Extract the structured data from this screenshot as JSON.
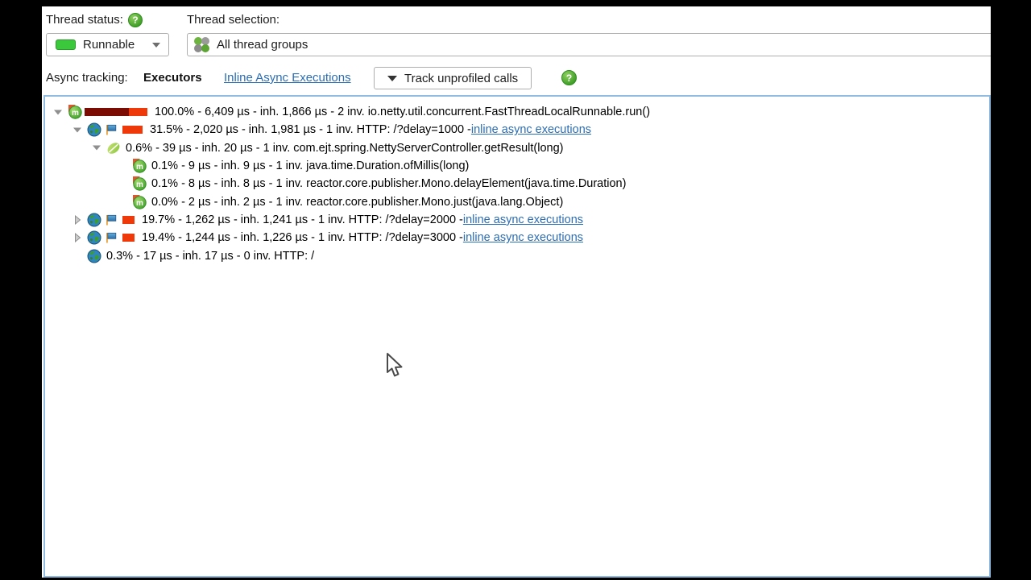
{
  "header": {
    "thread_status_label": "Thread status:",
    "thread_selection_label": "Thread selection:",
    "help_glyph": "?",
    "thread_status_value": "Runnable",
    "thread_selection_value": "All thread groups",
    "status_swatch_color": "#3cc83c"
  },
  "async": {
    "label": "Async tracking:",
    "mode": "Executors",
    "link": "Inline Async Executions",
    "button_label": "Track unprofiled calls"
  },
  "colors": {
    "link": "#2a6db5",
    "bar_total": "#7a0c04",
    "bar_inherent": "#ee3a0b",
    "panel_border": "#92bbe2",
    "status_green": "#3cc83c"
  },
  "tree": {
    "bar_full_width": 78,
    "rows": [
      {
        "indent": 9,
        "expander": "down",
        "icon": "method",
        "flag": false,
        "bar": {
          "pct": 100.0,
          "self_frac": 0.29
        },
        "text": "100.0% - 6,409 µs - inh. 1,866 µs - 2 inv. io.netty.util.concurrent.FastThreadLocalRunnable.run()",
        "link": null
      },
      {
        "indent": 33,
        "expander": "down",
        "icon": "globe",
        "flag": true,
        "bar": {
          "pct": 31.5,
          "self_frac": 0.98
        },
        "text": "31.5% - 2,020 µs - inh. 1,981 µs - 1 inv. HTTP: /?delay=1000 - ",
        "link": "inline async executions"
      },
      {
        "indent": 57,
        "expander": "down",
        "icon": "leaf",
        "flag": false,
        "bar": null,
        "text": "0.6% - 39 µs - inh. 20 µs - 1 inv. com.ejt.spring.NettyServerController.getResult(long)",
        "link": null
      },
      {
        "indent": 108,
        "expander": null,
        "icon": "method",
        "flag": false,
        "bar": null,
        "text": "0.1% - 9 µs - inh. 9 µs - 1 inv. java.time.Duration.ofMillis(long)",
        "link": null
      },
      {
        "indent": 108,
        "expander": null,
        "icon": "method",
        "flag": false,
        "bar": null,
        "text": "0.1% - 8 µs - inh. 8 µs - 1 inv. reactor.core.publisher.Mono.delayElement(java.time.Duration)",
        "link": null
      },
      {
        "indent": 108,
        "expander": null,
        "icon": "method",
        "flag": false,
        "bar": null,
        "text": "0.0% - 2 µs - inh. 2 µs - 1 inv. reactor.core.publisher.Mono.just(java.lang.Object)",
        "link": null
      },
      {
        "indent": 33,
        "expander": "right",
        "icon": "globe",
        "flag": true,
        "bar": {
          "pct": 19.7,
          "self_frac": 0.985
        },
        "text": "19.7% - 1,262 µs - inh. 1,241 µs - 1 inv. HTTP: /?delay=2000 - ",
        "link": "inline async executions"
      },
      {
        "indent": 33,
        "expander": "right",
        "icon": "globe",
        "flag": true,
        "bar": {
          "pct": 19.4,
          "self_frac": 0.985
        },
        "text": "19.4% - 1,244 µs - inh. 1,226 µs - 1 inv. HTTP: /?delay=3000 - ",
        "link": "inline async executions"
      },
      {
        "indent": 52,
        "expander": null,
        "icon": "globe",
        "flag": false,
        "bar": null,
        "text": "0.3% - 17 µs - inh. 17 µs - 0 inv. HTTP: /",
        "link": null
      }
    ]
  }
}
